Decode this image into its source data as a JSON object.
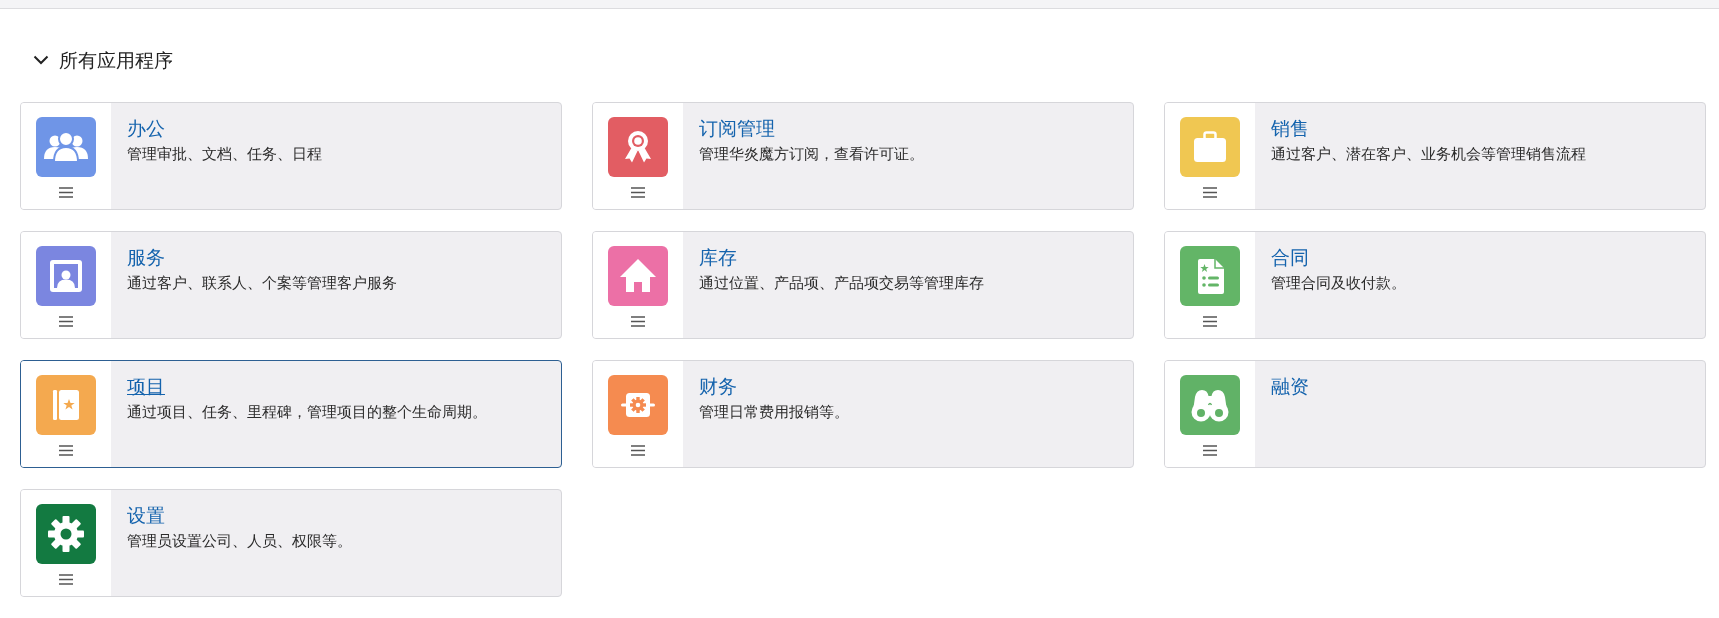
{
  "section": {
    "title": "所有应用程序",
    "expanded": true
  },
  "apps": [
    {
      "title": "办公",
      "description": "管理审批、文档、任务、日程",
      "color": "#6f95e7",
      "hovered": false
    },
    {
      "title": "订阅管理",
      "description": "管理华炎魔方订阅，查看许可证。",
      "color": "#e25d63",
      "hovered": false
    },
    {
      "title": "销售",
      "description": "通过客户、潜在客户、业务机会等管理销售流程",
      "color": "#f0c752",
      "hovered": false
    },
    {
      "title": "服务",
      "description": "通过客户、联系人、个案等管理客户服务",
      "color": "#7b86e0",
      "hovered": false
    },
    {
      "title": "库存",
      "description": "通过位置、产品项、产品项交易等管理库存",
      "color": "#ec70a6",
      "hovered": false
    },
    {
      "title": "合同",
      "description": "管理合同及收付款。",
      "color": "#63b567",
      "hovered": false
    },
    {
      "title": "项目",
      "description": "通过项目、任务、里程碑，管理项目的整个生命周期。",
      "color": "#f4a94f",
      "hovered": true
    },
    {
      "title": "财务",
      "description": "管理日常费用报销等。",
      "color": "#f58b50",
      "hovered": false
    },
    {
      "title": "融资",
      "color": "#61b267",
      "hovered": false
    },
    {
      "title": "设置",
      "description": "管理员设置公司、人员、权限等。",
      "color": "#137a41",
      "hovered": false
    }
  ]
}
